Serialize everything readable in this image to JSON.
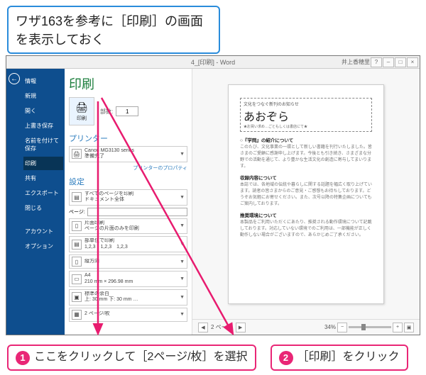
{
  "top_callout": "ワザ163を参考に［印刷］の画面を表示しておく",
  "titlebar": {
    "doc": "4_[印刷] - Word",
    "user": "井上香穂里"
  },
  "sidebar": {
    "items": [
      {
        "label": "情報"
      },
      {
        "label": "新規"
      },
      {
        "label": "開く"
      },
      {
        "label": "上書き保存"
      },
      {
        "label": "名前を付けて保存"
      },
      {
        "label": "印刷",
        "active": true
      },
      {
        "label": "共有"
      },
      {
        "label": "エクスポート"
      },
      {
        "label": "閉じる"
      },
      {
        "label": "アカウント"
      },
      {
        "label": "オプション"
      }
    ]
  },
  "center": {
    "heading": "印刷",
    "print_label": "印刷",
    "copies_label": "部数:",
    "copies_value": "1",
    "printer_h": "プリンター",
    "printer": {
      "name": "Canon MG3130 series",
      "status": "準備完了"
    },
    "printer_link": "プリンターのプロパティ",
    "settings_h": "設定",
    "range": {
      "main": "すべてのページを印刷",
      "sub": "ドキュメント全体"
    },
    "page_label": "ページ:",
    "page_value": "",
    "side": {
      "main": "片面印刷",
      "sub": "ページの片面のみを印刷"
    },
    "collate": {
      "main": "部単位で印刷",
      "sub": "1,2,3　1,2,3　1,2,3"
    },
    "orient": {
      "main": "縦方向",
      "sub": ""
    },
    "paper": {
      "main": "A4",
      "sub": "210 mm × 296.98 mm"
    },
    "margin": {
      "main": "標準の余白",
      "sub": "上: 30 mm 下: 30 mm …"
    },
    "per": {
      "main": "2 ページ/枚",
      "sub": ""
    }
  },
  "preview": {
    "doc_title_small": "文化をつなぐ新刊のお知らせ",
    "doc_title_big": "あおぞら",
    "doc_title_sub": "★お買い求め…ごともしくは書店にて★",
    "h1": "○『学問』の紹介について",
    "h2": "収録内容について",
    "h3": "推奨環境について",
    "nav_page": "2 ページ",
    "zoom": "34%"
  },
  "callouts": {
    "c1_num": "1",
    "c1_text": "ここをクリックして［2ページ/枚］を選択",
    "c2_num": "2",
    "c2_text": "［印刷］をクリック"
  },
  "lorem1": "このたび、文化事業の一環として新しい書籍を刊行いたしました。皆さまのご愛顧に感謝申し上げます。今後とも引き続き、さまざまな分野での活動を通じて、より豊かな生活文化の創造に寄与してまいります。",
  "lorem2": "本誌では、各地域の伝統や暮らしに関する話題を幅広く取り上げています。読者の皆さまからのご意見・ご感想もお待ちしております。どうぞお気軽にお寄せください。また、次号以降の特集企画についてもご案内しております。",
  "lorem3": "本製品をご利用いただくにあたり、推奨される動作環境について記載しております。対応していない環境でのご利用は、一部機能が正しく動作しない場合がございますので、あらかじめご了承ください。"
}
